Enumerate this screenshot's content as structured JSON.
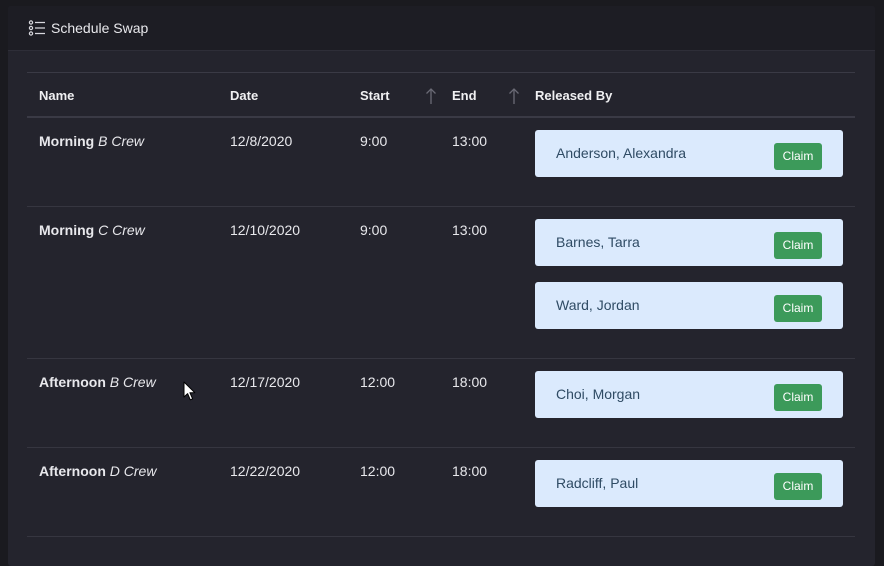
{
  "header": {
    "icon": "list-icon",
    "title": "Schedule Swap"
  },
  "table": {
    "columns": {
      "name": "Name",
      "date": "Date",
      "start": "Start",
      "end": "End",
      "released_by": "Released By"
    },
    "sort_icon": "arrow-up-icon",
    "rows": [
      {
        "shift": "Morning",
        "crew": "B Crew",
        "date": "12/8/2020",
        "start": "9:00",
        "end": "13:00",
        "released_by": [
          {
            "name": "Anderson, Alexandra",
            "action": "Claim"
          }
        ]
      },
      {
        "shift": "Morning",
        "crew": "C Crew",
        "date": "12/10/2020",
        "start": "9:00",
        "end": "13:00",
        "released_by": [
          {
            "name": "Barnes, Tarra",
            "action": "Claim"
          },
          {
            "name": "Ward, Jordan",
            "action": "Claim"
          }
        ]
      },
      {
        "shift": "Afternoon",
        "crew": "B Crew",
        "date": "12/17/2020",
        "start": "12:00",
        "end": "18:00",
        "released_by": [
          {
            "name": "Choi, Morgan",
            "action": "Claim"
          }
        ]
      },
      {
        "shift": "Afternoon",
        "crew": "D Crew",
        "date": "12/22/2020",
        "start": "12:00",
        "end": "18:00",
        "released_by": [
          {
            "name": "Radcliff, Paul",
            "action": "Claim"
          }
        ]
      }
    ]
  },
  "colors": {
    "background": "#1a1a1f",
    "card": "#24242d",
    "release_box": "#dbeafd",
    "claim_button": "#3c9a5a"
  }
}
